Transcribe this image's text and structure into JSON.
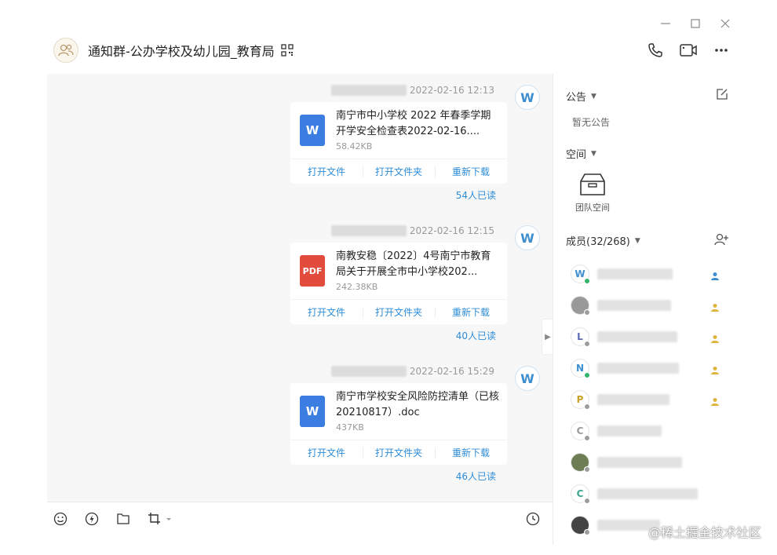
{
  "window": {
    "controls": [
      "minimize-icon",
      "maximize-icon",
      "close-icon"
    ]
  },
  "header": {
    "title": "通知群-公办学校及幼儿园_教育局",
    "actions": [
      "phone-icon",
      "video-icon",
      "more-icon"
    ]
  },
  "messages": [
    {
      "time": "2022-02-16 12:13",
      "file_type": "W",
      "file_name": "南宁市中小学校 2022 年春季学期开学安全检查表2022-02-16....",
      "file_size": "58.42KB",
      "actions": [
        "打开文件",
        "打开文件夹",
        "重新下载"
      ],
      "read": "54人已读"
    },
    {
      "time": "2022-02-16 12:15",
      "file_type": "PDF",
      "file_name": "南教安稳〔2022〕4号南宁市教育局关于开展全市中小学校202...",
      "file_size": "242.38KB",
      "actions": [
        "打开文件",
        "打开文件夹",
        "重新下载"
      ],
      "read": "40人已读"
    },
    {
      "time": "2022-02-16 15:29",
      "file_type": "W",
      "file_name": "南宁市学校安全风险防控清单（已核20210817）.doc",
      "file_size": "437KB",
      "actions": [
        "打开文件",
        "打开文件夹",
        "重新下载"
      ],
      "read": "46人已读"
    }
  ],
  "sidebar": {
    "announcement_label": "公告",
    "announcement_empty": "暂无公告",
    "space_label": "空间",
    "team_space": "团队空间",
    "members_label": "成员(32/268)",
    "members": [
      {
        "initial": "W",
        "color": "#3e8ed0",
        "online": true,
        "role": "admin"
      },
      {
        "initial": "",
        "color": "#999999",
        "online": false,
        "role": "owner"
      },
      {
        "initial": "L",
        "color": "#5a6ab8",
        "online": false,
        "role": "owner"
      },
      {
        "initial": "N",
        "color": "#3e8ed0",
        "online": true,
        "role": "owner"
      },
      {
        "initial": "P",
        "color": "#c9a227",
        "online": false,
        "role": "owner"
      },
      {
        "initial": "C",
        "color": "#9a9a9a",
        "online": false,
        "role": ""
      },
      {
        "initial": "",
        "color": "#6f7d55",
        "online": false,
        "role": ""
      },
      {
        "initial": "C",
        "color": "#3aa58c",
        "online": false,
        "role": ""
      },
      {
        "initial": "",
        "color": "#444444",
        "online": false,
        "role": ""
      }
    ]
  },
  "watermark": "@稀土掘金技术社区",
  "colors": {
    "link": "#2d8cd6",
    "word": "#3b7de0",
    "pdf": "#e14c3c"
  }
}
